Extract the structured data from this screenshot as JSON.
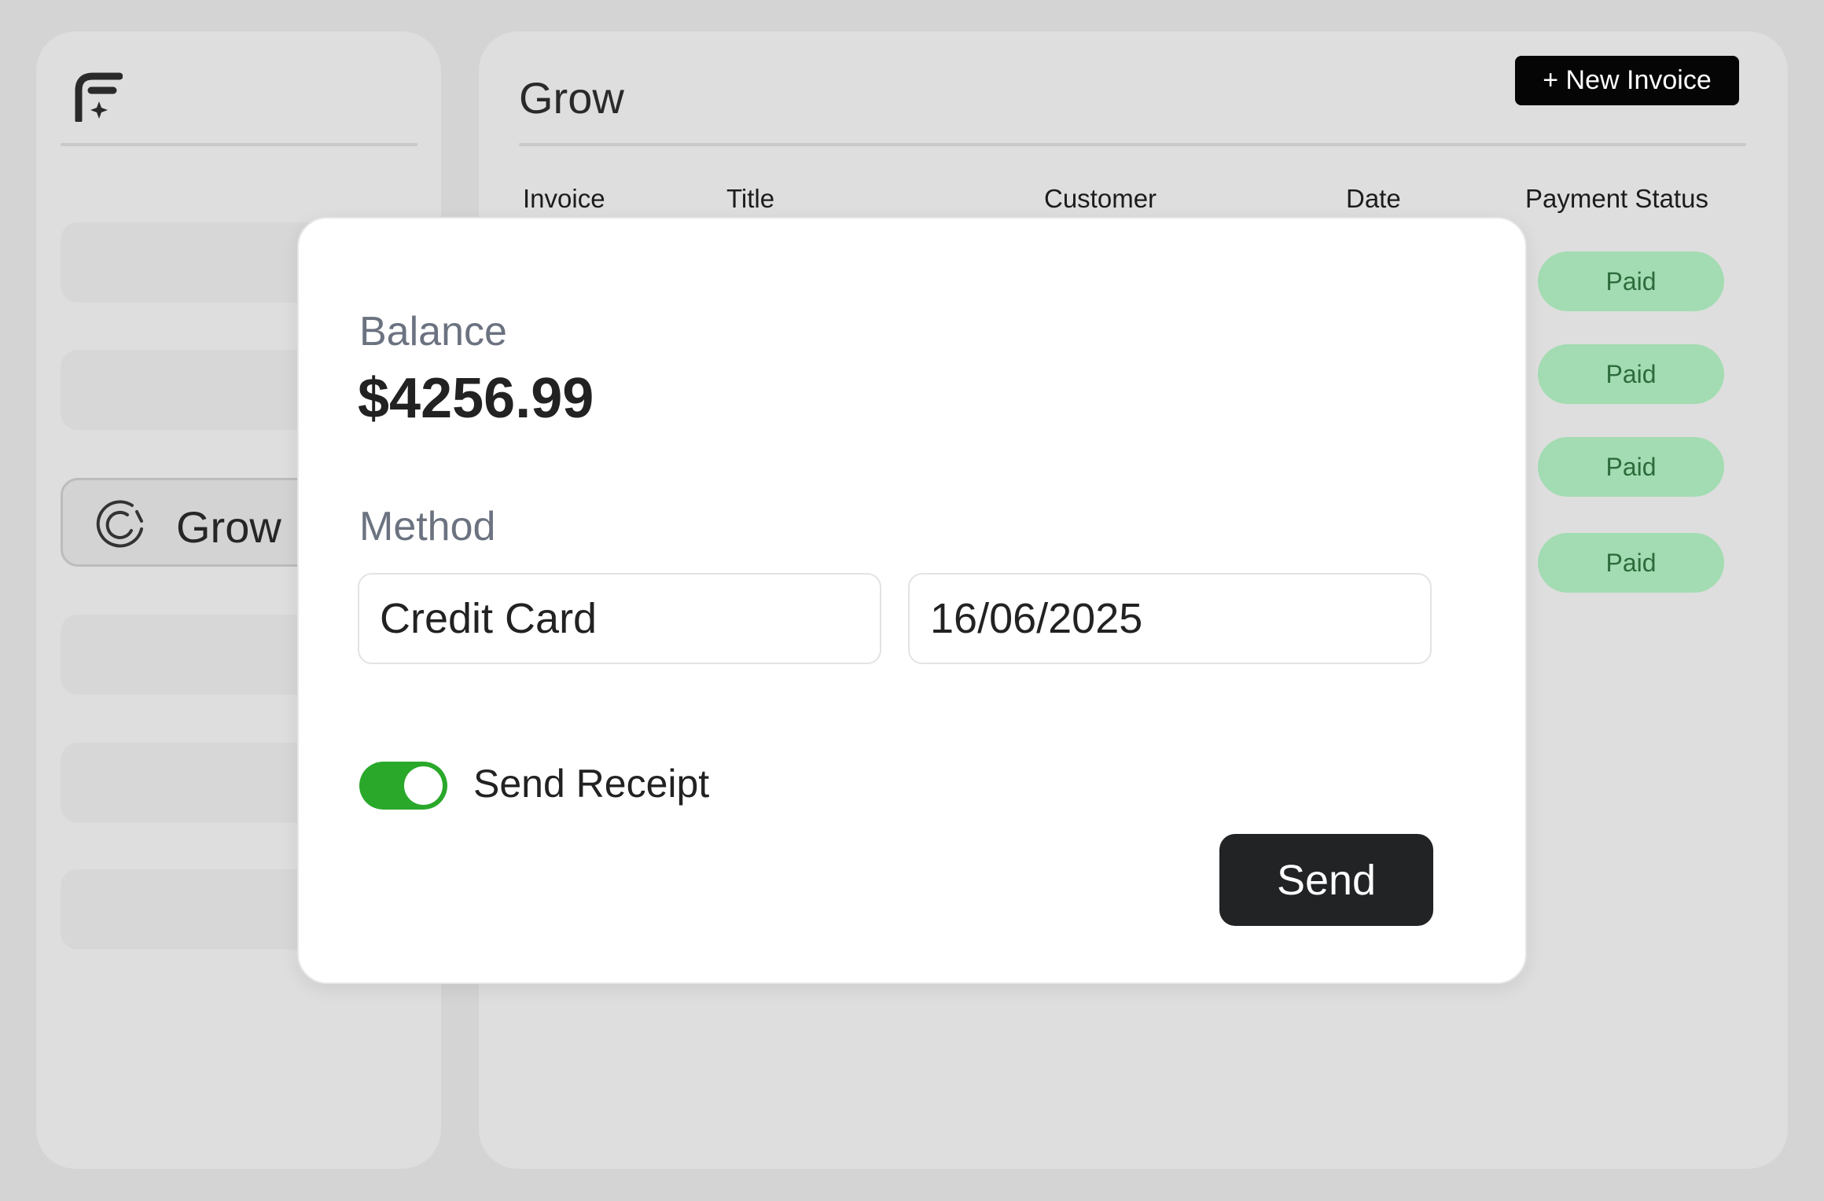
{
  "sidebar": {
    "active_item": {
      "label": "Grow",
      "icon": "grow-icon"
    },
    "logo_icon": "brand-logo-icon"
  },
  "header": {
    "title": "Grow",
    "new_invoice_label": "+ New Invoice"
  },
  "table": {
    "columns": [
      "Invoice",
      "Title",
      "Customer",
      "Date",
      "Payment Status"
    ],
    "rows": [
      {
        "status": "Paid"
      },
      {
        "status": "Paid"
      },
      {
        "status": "Paid"
      },
      {
        "status": "Paid"
      }
    ]
  },
  "modal": {
    "balance_label": "Balance",
    "balance_value": "$4256.99",
    "method_label": "Method",
    "method_value": "Credit Card",
    "date_value": "16/06/2025",
    "send_receipt_label": "Send Receipt",
    "send_receipt_enabled": true,
    "send_label": "Send"
  },
  "colors": {
    "accent_toggle": "#2aa82a",
    "paid_badge_bg": "#a3dcb2",
    "paid_badge_text": "#2c6b3c",
    "primary_button": "#222325"
  }
}
